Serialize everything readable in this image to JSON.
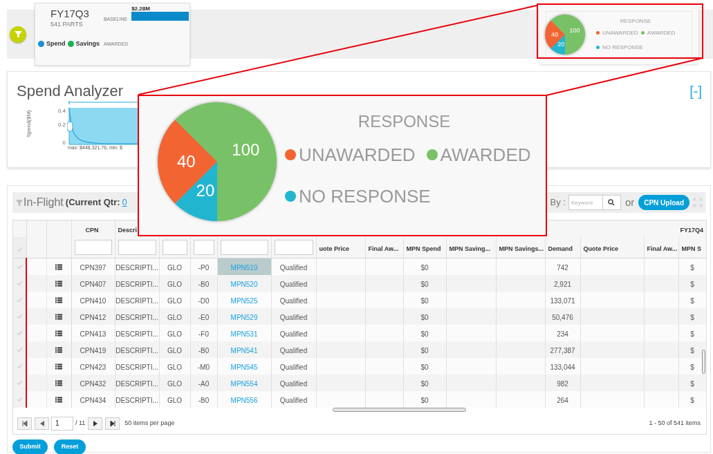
{
  "summary_card": {
    "title": "FY17Q3",
    "parts": "541 PARTS",
    "bar_label": "BASELINE",
    "bar_value": "$2.28M",
    "legend": [
      {
        "label": "Spend",
        "color": "#1b8fd2"
      },
      {
        "label": "Savings",
        "color": "#1db257"
      }
    ],
    "legend_note": "AWARDED"
  },
  "response_card": {
    "legend": [
      {
        "color": "#f26532"
      },
      {
        "color": "#78c166"
      },
      {
        "color": "#22b5d0"
      }
    ],
    "chart_data": {
      "type": "pie",
      "title": "RESPONSE",
      "categories": [
        "UNAWARDED",
        "AWARDED",
        "NO RESPONSE"
      ],
      "values": [
        40,
        100,
        20
      ],
      "data_labels": true
    }
  },
  "magnified_response_card": {
    "legend": [
      {
        "color": "#f26532"
      },
      {
        "color": "#78c166"
      },
      {
        "color": "#22b5d0"
      }
    ],
    "chart_data": {
      "type": "pie",
      "title": "RESPONSE",
      "categories": [
        "UNAWARDED",
        "AWARDED",
        "NO RESPONSE"
      ],
      "values": [
        40,
        100,
        20
      ],
      "data_labels": true
    }
  },
  "spend_analyzer": {
    "title": "Spend Analyzer",
    "collapse": "[-]",
    "ylabel": "Spend($M)",
    "tick_labels": [
      "0.4",
      "0.2",
      "0"
    ],
    "range_text": "max: $448,321.76, min: $"
  },
  "in_flight": {
    "title": "In-Flight",
    "qtr_label": "(Current Qtr:",
    "qtr_link": "0",
    "search_label": "By :",
    "keyword_placeholder": "Keyword",
    "or": "or",
    "upload_button": "CPN Upload",
    "table": {
      "group_headers": [
        {
          "label": "FY17Q4"
        }
      ],
      "columns": [
        {
          "label": "CPN",
          "filter": true,
          "kind": "text"
        },
        {
          "label": "Descri",
          "filter": true,
          "kind": "text"
        },
        {
          "filter": true,
          "kind": "text"
        },
        {
          "filter": true,
          "kind": "text"
        },
        {
          "filter": true,
          "kind": "link"
        },
        {
          "filter": true,
          "kind": "text"
        },
        {
          "label": "uote Price",
          "filter": false,
          "kind": "text"
        },
        {
          "label": "Final Aw...",
          "filter": false,
          "kind": "text"
        },
        {
          "label": "MPN Spend",
          "filter": false,
          "kind": "text"
        },
        {
          "label": "MPN Saving...",
          "filter": false,
          "kind": "text"
        },
        {
          "label": "MPN Savings...",
          "filter": false,
          "kind": "text"
        },
        {
          "label": "Demand",
          "filter": false,
          "kind": "text"
        },
        {
          "label": "Quote Price",
          "filter": false,
          "kind": "text"
        },
        {
          "label": "Final Aw...",
          "filter": false,
          "kind": "text"
        },
        {
          "label": "MPN S",
          "filter": false,
          "kind": "text"
        }
      ],
      "rows": [
        {
          "cells": [
            "CPN397",
            "DESCRIPTI...",
            "GLO",
            "-P0",
            "MPN510",
            "Qualified",
            null,
            null,
            "$0",
            null,
            null,
            "742",
            null,
            null,
            "$"
          ],
          "mpn_highlighted": true
        },
        {
          "cells": [
            "CPN407",
            "DESCRIPTI...",
            "GLO",
            "-B0",
            "MPN520",
            "Qualified",
            null,
            null,
            "$0",
            null,
            null,
            "2,921",
            null,
            null,
            "$"
          ],
          "mpn_highlighted": false
        },
        {
          "cells": [
            "CPN410",
            "DESCRIPTI...",
            "GLO",
            "-D0",
            "MPN525",
            "Qualified",
            null,
            null,
            "$0",
            null,
            null,
            "133,071",
            null,
            null,
            "$"
          ],
          "mpn_highlighted": false
        },
        {
          "cells": [
            "CPN412",
            "DESCRIPTI...",
            "GLO",
            "-E0",
            "MPN529",
            "Qualified",
            null,
            null,
            "$0",
            null,
            null,
            "50,476",
            null,
            null,
            "$"
          ],
          "mpn_highlighted": false
        },
        {
          "cells": [
            "CPN413",
            "DESCRIPTI...",
            "GLO",
            "-F0",
            "MPN531",
            "Qualified",
            null,
            null,
            "$0",
            null,
            null,
            "234",
            null,
            null,
            "$"
          ],
          "mpn_highlighted": false
        },
        {
          "cells": [
            "CPN419",
            "DESCRIPTI...",
            "GLO",
            "-B0",
            "MPN541",
            "Qualified",
            null,
            null,
            "$0",
            null,
            null,
            "277,387",
            null,
            null,
            "$"
          ],
          "mpn_highlighted": false
        },
        {
          "cells": [
            "CPN423",
            "DESCRIPTI...",
            "GLO",
            "-M0",
            "MPN545",
            "Qualified",
            null,
            null,
            "$0",
            null,
            null,
            "133,044",
            null,
            null,
            "$"
          ],
          "mpn_highlighted": false
        },
        {
          "cells": [
            "CPN432",
            "DESCRIPTI...",
            "GLO",
            "-A0",
            "MPN554",
            "Qualified",
            null,
            null,
            "$0",
            null,
            null,
            "982",
            null,
            null,
            "$"
          ],
          "mpn_highlighted": false
        },
        {
          "cells": [
            "CPN434",
            "DESCRIPTI...",
            "GLO",
            "-B0",
            "MPN556",
            "Qualified",
            null,
            null,
            "$0",
            null,
            null,
            "264",
            null,
            null,
            "$"
          ],
          "mpn_highlighted": false
        }
      ]
    },
    "pager": {
      "page": "1",
      "total_pages": "/ 11",
      "per_page": "50 items per page",
      "range": "1 - 50 of 541 items"
    },
    "buttons": [
      "Submit",
      "Reset"
    ]
  }
}
